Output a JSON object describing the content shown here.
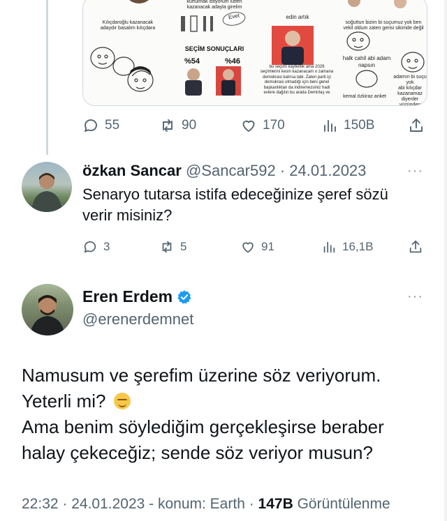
{
  "media": {
    "panel1": {
      "caption": "Kılıçdaroğlu kazanacak\nadaydır basalım kılıçdara"
    },
    "panel2": {
      "top_text": "kurtulmak istiyorum lütfen\nkazanacak adayla girelim",
      "ballot_word": "Evet",
      "results_title": "SEÇİM SONUÇLARI",
      "pct_left": "%54",
      "pct_right": "%46"
    },
    "panel3": {
      "top_text": "edin artık",
      "body_text": "bu seçimi kaybettik ama 2029\nseçimlerini kesin kazanacam o zamana\ndemokrasi kalırsa tabi. Zaten parti içi\ndemokrasi olmadığı için beni genel\nbaşkanlıktan da indiremezsiniz hadi\nevlere dağılın bu arada Demirtaş ve"
    },
    "panel4": {
      "top_text": "soğuttun bizim bi suçumuz yok ben\nvekil oldum zaten gerisi sikimde değil",
      "mid_text": "halk cahil abi adam\nnapsın",
      "right_text": "adamın bi suçu yok\nabi kılıçdar\nkazanamaz\ndiyenler yüzünden",
      "bottom_text": "kemal özkiraz anket"
    }
  },
  "first_actions": {
    "replies": "55",
    "retweets": "90",
    "likes": "170",
    "views": "150B"
  },
  "reply": {
    "name": "özkan Sancar",
    "handle": "@Sancar592",
    "separator": "·",
    "date": "24.01.2023",
    "text": "Senaryo tutarsa istifa edeceğinize şeref sözü verir misiniz?",
    "actions": {
      "replies": "3",
      "retweets": "5",
      "likes": "91",
      "views": "16,1B"
    }
  },
  "main": {
    "name": "Eren Erdem",
    "handle": "@erenerdemnet",
    "line1": "Namusum ve şerefim üzerine söz veriyorum.",
    "line2": "Yeterli mi?",
    "line3": "Ama benim söylediğim gerçekleşirse beraber",
    "line4": "halay çekeceğiz; sende söz veriyor musun?",
    "meta_prefix": "22:32 · 24.01.2023 - konum: Earth · ",
    "views_count": "147B",
    "views_label": " Görüntülenme"
  },
  "more_glyph": "···",
  "colors": {
    "secondary_text": "#536471",
    "verified": "#1d9bf0",
    "divider": "#cfd9de"
  }
}
